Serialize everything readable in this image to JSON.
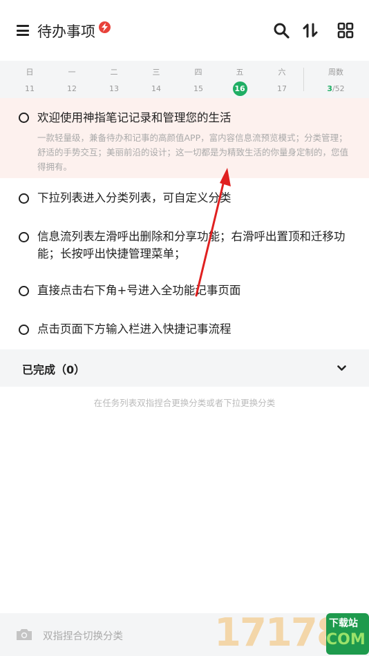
{
  "header": {
    "title": "待办事项",
    "badge_icon": "lightning-icon",
    "actions": [
      "search-icon",
      "sort-icon",
      "grid-view-icon"
    ]
  },
  "calendar": {
    "days": [
      {
        "weekday": "日",
        "date": "11"
      },
      {
        "weekday": "一",
        "date": "12"
      },
      {
        "weekday": "二",
        "date": "13"
      },
      {
        "weekday": "三",
        "date": "14"
      },
      {
        "weekday": "四",
        "date": "15"
      },
      {
        "weekday": "五",
        "date": "16"
      },
      {
        "weekday": "六",
        "date": "17"
      }
    ],
    "today_index": 5,
    "weeks_label": "周数",
    "current_week": "3",
    "total_weeks": "/52"
  },
  "tasks": [
    {
      "title": "欢迎使用神指笔记记录和管理您的生活",
      "desc": "一款轻量级，兼备待办和记事的高颜值APP，富内容信息流预览模式；分类管理；舒适的手势交互；美丽前沿的设计；这一切都是为精致生活的你量身定制的，您值得拥有。"
    },
    {
      "title": "下拉列表进入分类列表，可自定义分类"
    },
    {
      "title": "信息流列表左滑呼出删除和分享功能；右滑呼出置顶和迁移功能；长按呼出快捷管理菜单；"
    },
    {
      "title": "直接点击右下角+号进入全功能记事页面"
    },
    {
      "title": "点击页面下方输入栏进入快捷记事流程"
    }
  ],
  "completed": {
    "label": "已完成（0）"
  },
  "hint": "在任务列表双指捏合更换分类或者下拉更换分类",
  "input_bar": {
    "placeholder": "双指捏合切换分类"
  },
  "watermark": {
    "digits": "17178",
    "top_text": "下载站",
    "bottom_text": "COM"
  },
  "colors": {
    "accent": "#1fae64",
    "highlight_bg": "#fdf1ee",
    "badge": "#e8413a",
    "arrow": "#e02020"
  }
}
